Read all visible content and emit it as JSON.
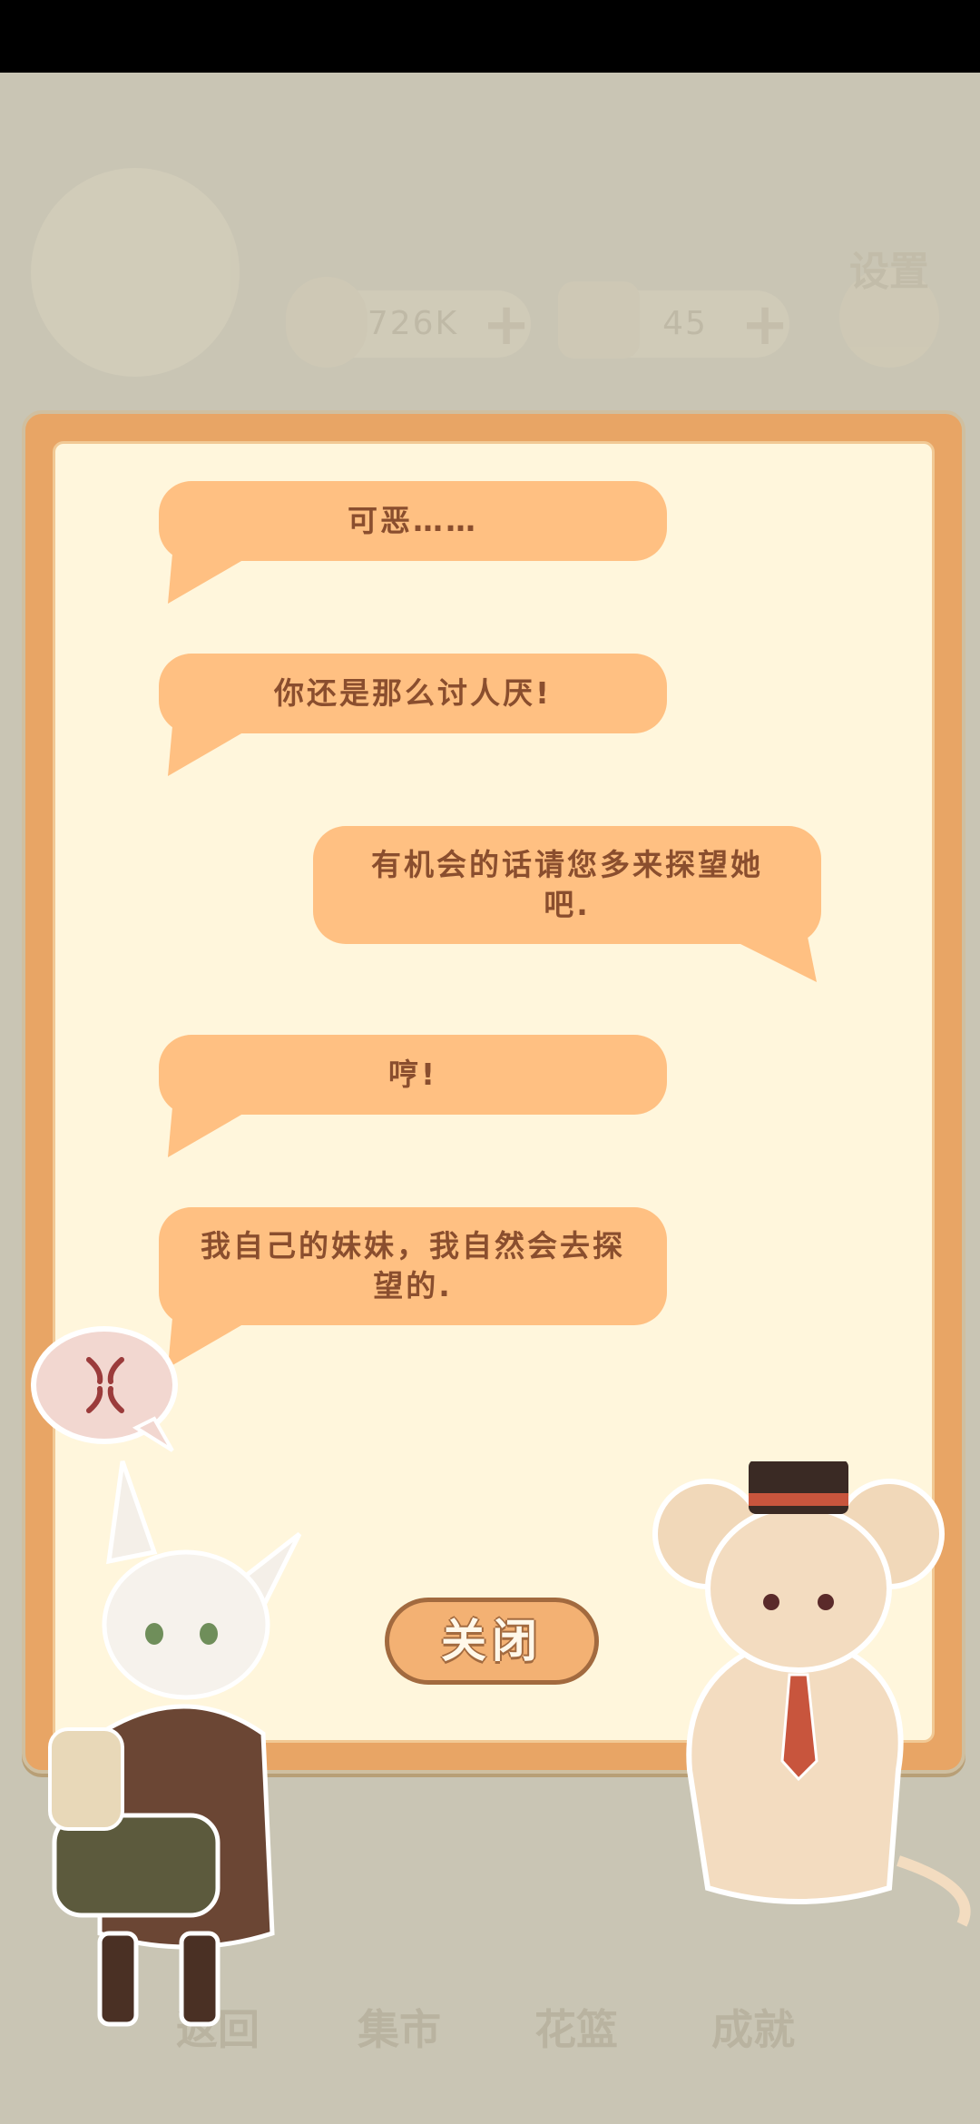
{
  "background_ui": {
    "currency_fish": "726K",
    "currency_cake": "45",
    "settings_label": "设置",
    "bottom_nav": [
      "返回",
      "集市",
      "花篮",
      "成就"
    ]
  },
  "dialog": {
    "messages": [
      {
        "speaker": "left",
        "text": "可恶……"
      },
      {
        "speaker": "left",
        "text": "你还是那么讨人厌!"
      },
      {
        "speaker": "right",
        "text": "有机会的话请您多来探望她吧."
      },
      {
        "speaker": "left",
        "text": "哼!"
      },
      {
        "speaker": "left",
        "text": "我自己的妹妹，我自然会去探望的."
      }
    ],
    "close_label": "关闭"
  },
  "colors": {
    "bubble": "#ffc082",
    "bubble_text": "#8a4e2e",
    "panel_border": "#e8a565",
    "panel_fill": "#fff6dc"
  },
  "icons": {
    "anger": "anger-mark-icon"
  }
}
